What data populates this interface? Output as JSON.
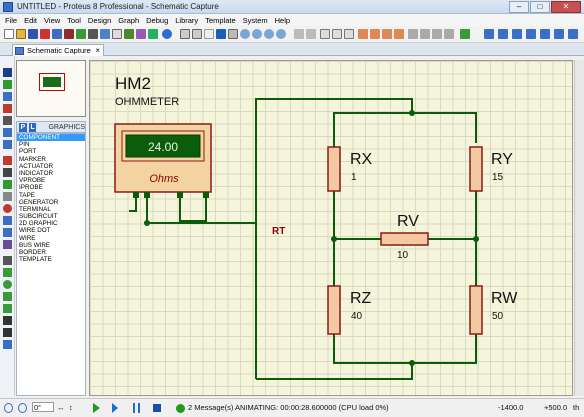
{
  "window": {
    "title": "UNTITLED - Proteus 8 Professional - Schematic Capture",
    "minimize": "–",
    "maximize": "□",
    "close": "✕"
  },
  "menu": [
    "File",
    "Edit",
    "View",
    "Tool",
    "Design",
    "Graph",
    "Debug",
    "Library",
    "Template",
    "System",
    "Help"
  ],
  "tab": {
    "label": "Schematic Capture",
    "close": "×"
  },
  "mode_panel": {
    "p_button": "P",
    "l_button": "L",
    "title": "GRAPHICS",
    "items": [
      "COMPONENT",
      "PIN",
      "PORT",
      "MARKER",
      "ACTUATOR",
      "INDICATOR",
      "VPROBE",
      "IPROBE",
      "TAPE",
      "GENERATOR",
      "TERMINAL",
      "SUBCIRCUIT",
      "2D GRAPHIC",
      "WIRE DOT",
      "WIRE",
      "BUS WIRE",
      "BORDER",
      "TEMPLATE"
    ],
    "selected": "COMPONENT"
  },
  "schematic": {
    "meter": {
      "ref": "HM2",
      "type": "OHMMETER",
      "display": "24.00",
      "unit": "Ohms"
    },
    "net_label": "RT",
    "resistors": [
      {
        "ref": "RX",
        "value": "1"
      },
      {
        "ref": "RY",
        "value": "15"
      },
      {
        "ref": "RV",
        "value": "10"
      },
      {
        "ref": "RZ",
        "value": "40"
      },
      {
        "ref": "RW",
        "value": "50"
      }
    ],
    "colors": {
      "wire": "#0a5c0a",
      "resistor_fill": "#f2c9a0",
      "resistor_stroke": "#8b1a1a",
      "label": "#8b0000",
      "meter_body": "#f3d3a0",
      "meter_display": "#0b5c0b"
    }
  },
  "statusbar": {
    "rotation": "0°",
    "messages": "2 Message(s)",
    "status": "ANIMATING: 00:00:28.600000 (CPU load 0%)",
    "coord_x": "-1400.0",
    "coord_y": "+500.0",
    "units": "th"
  }
}
